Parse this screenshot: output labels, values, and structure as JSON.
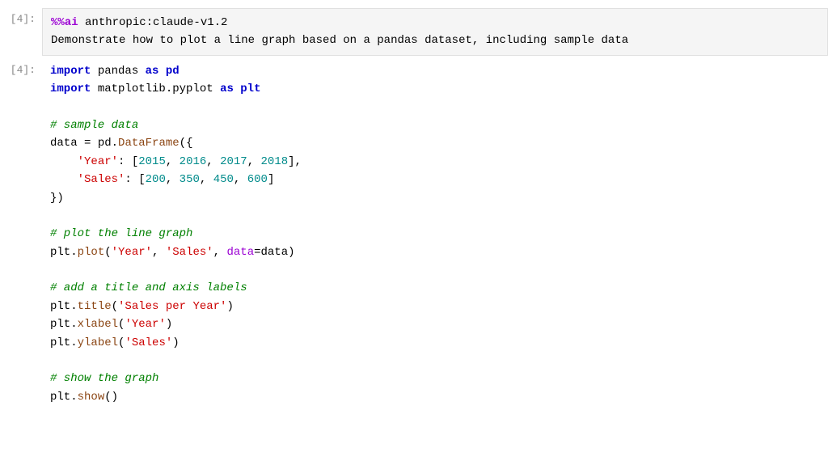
{
  "cells": [
    {
      "label": "[4]:",
      "type": "magic",
      "lines": [
        {
          "parts": [
            {
              "text": "%%ai",
              "cls": "c-magic"
            },
            {
              "text": " anthropic:claude-v1.2",
              "cls": "c-module"
            }
          ]
        },
        {
          "parts": [
            {
              "text": "Demonstrate how to plot a line graph based on a pandas dataset, including sample data",
              "cls": "c-module"
            }
          ]
        }
      ]
    },
    {
      "label": "[4]:",
      "type": "code",
      "lines": [
        {
          "parts": [
            {
              "text": "import",
              "cls": "c-keyword"
            },
            {
              "text": " pandas ",
              "cls": "c-module"
            },
            {
              "text": "as",
              "cls": "c-keyword"
            },
            {
              "text": " pd",
              "cls": "c-alias"
            }
          ]
        },
        {
          "parts": [
            {
              "text": "import",
              "cls": "c-keyword"
            },
            {
              "text": " matplotlib.pyplot ",
              "cls": "c-module"
            },
            {
              "text": "as",
              "cls": "c-keyword"
            },
            {
              "text": " plt",
              "cls": "c-alias"
            }
          ]
        },
        {
          "empty": true
        },
        {
          "parts": [
            {
              "text": "# sample data",
              "cls": "c-comment"
            }
          ]
        },
        {
          "parts": [
            {
              "text": "data ",
              "cls": "c-variable"
            },
            {
              "text": "= ",
              "cls": "c-operator"
            },
            {
              "text": "pd.",
              "cls": "c-module"
            },
            {
              "text": "DataFrame",
              "cls": "c-function"
            },
            {
              "text": "({",
              "cls": "c-punctuation"
            }
          ]
        },
        {
          "parts": [
            {
              "text": "    ",
              "cls": "c-module"
            },
            {
              "text": "'Year'",
              "cls": "c-string"
            },
            {
              "text": ": [",
              "cls": "c-punctuation"
            },
            {
              "text": "2015",
              "cls": "c-number"
            },
            {
              "text": ", ",
              "cls": "c-punctuation"
            },
            {
              "text": "2016",
              "cls": "c-number"
            },
            {
              "text": ", ",
              "cls": "c-punctuation"
            },
            {
              "text": "2017",
              "cls": "c-number"
            },
            {
              "text": ", ",
              "cls": "c-punctuation"
            },
            {
              "text": "2018",
              "cls": "c-number"
            },
            {
              "text": "],",
              "cls": "c-punctuation"
            }
          ]
        },
        {
          "parts": [
            {
              "text": "    ",
              "cls": "c-module"
            },
            {
              "text": "'Sales'",
              "cls": "c-string"
            },
            {
              "text": ": [",
              "cls": "c-punctuation"
            },
            {
              "text": "200",
              "cls": "c-number"
            },
            {
              "text": ", ",
              "cls": "c-punctuation"
            },
            {
              "text": "350",
              "cls": "c-number"
            },
            {
              "text": ", ",
              "cls": "c-punctuation"
            },
            {
              "text": "450",
              "cls": "c-number"
            },
            {
              "text": ", ",
              "cls": "c-punctuation"
            },
            {
              "text": "600",
              "cls": "c-number"
            },
            {
              "text": "]",
              "cls": "c-punctuation"
            }
          ]
        },
        {
          "parts": [
            {
              "text": "})",
              "cls": "c-punctuation"
            }
          ]
        },
        {
          "empty": true
        },
        {
          "parts": [
            {
              "text": "# plot the line graph",
              "cls": "c-comment"
            }
          ]
        },
        {
          "parts": [
            {
              "text": "plt.",
              "cls": "c-module"
            },
            {
              "text": "plot",
              "cls": "c-function"
            },
            {
              "text": "(",
              "cls": "c-punctuation"
            },
            {
              "text": "'Year'",
              "cls": "c-string"
            },
            {
              "text": ", ",
              "cls": "c-punctuation"
            },
            {
              "text": "'Sales'",
              "cls": "c-string"
            },
            {
              "text": ", ",
              "cls": "c-punctuation"
            },
            {
              "text": "data",
              "cls": "c-param-keyword"
            },
            {
              "text": "=",
              "cls": "c-operator"
            },
            {
              "text": "data",
              "cls": "c-variable"
            },
            {
              "text": ")",
              "cls": "c-punctuation"
            }
          ]
        },
        {
          "empty": true
        },
        {
          "parts": [
            {
              "text": "# add a title and axis labels",
              "cls": "c-comment"
            }
          ]
        },
        {
          "parts": [
            {
              "text": "plt.",
              "cls": "c-module"
            },
            {
              "text": "title",
              "cls": "c-function"
            },
            {
              "text": "(",
              "cls": "c-punctuation"
            },
            {
              "text": "'Sales per Year'",
              "cls": "c-string"
            },
            {
              "text": ")",
              "cls": "c-punctuation"
            }
          ]
        },
        {
          "parts": [
            {
              "text": "plt.",
              "cls": "c-module"
            },
            {
              "text": "xlabel",
              "cls": "c-function"
            },
            {
              "text": "(",
              "cls": "c-punctuation"
            },
            {
              "text": "'Year'",
              "cls": "c-string"
            },
            {
              "text": ")",
              "cls": "c-punctuation"
            }
          ]
        },
        {
          "parts": [
            {
              "text": "plt.",
              "cls": "c-module"
            },
            {
              "text": "ylabel",
              "cls": "c-function"
            },
            {
              "text": "(",
              "cls": "c-punctuation"
            },
            {
              "text": "'Sales'",
              "cls": "c-string"
            },
            {
              "text": ")",
              "cls": "c-punctuation"
            }
          ]
        },
        {
          "empty": true
        },
        {
          "parts": [
            {
              "text": "# show the graph",
              "cls": "c-comment"
            }
          ]
        },
        {
          "parts": [
            {
              "text": "plt.",
              "cls": "c-module"
            },
            {
              "text": "show",
              "cls": "c-function"
            },
            {
              "text": "()",
              "cls": "c-punctuation"
            }
          ]
        }
      ]
    }
  ]
}
